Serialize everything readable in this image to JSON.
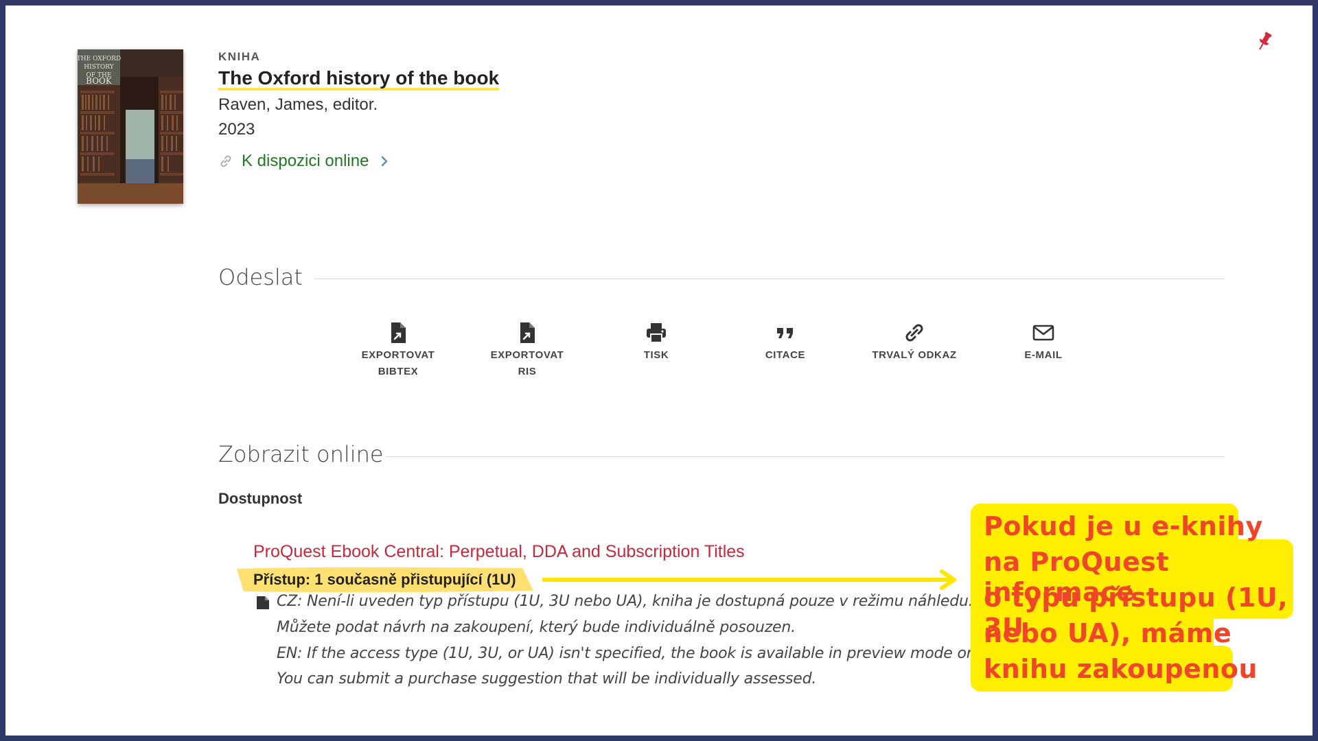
{
  "record": {
    "type": "KNIHA",
    "title": "The Oxford history of the book",
    "author": "Raven, James, editor.",
    "year": "2023",
    "online_link": "K dispozici online",
    "cover_lettering": "THE OXFORD HISTORY OF THE BOOK"
  },
  "send": {
    "heading": "Odeslat",
    "actions": [
      {
        "line1": "EXPORTOVAT",
        "line2": "BIBTEX",
        "icon": "file-export-icon"
      },
      {
        "line1": "EXPORTOVAT",
        "line2": "RIS",
        "icon": "file-export-icon"
      },
      {
        "line1": "TISK",
        "line2": "",
        "icon": "print-icon"
      },
      {
        "line1": "CITACE",
        "line2": "",
        "icon": "quote-icon"
      },
      {
        "line1": "TRVALÝ ODKAZ",
        "line2": "",
        "icon": "link-icon"
      },
      {
        "line1": "E-MAIL",
        "line2": "",
        "icon": "envelope-icon"
      }
    ]
  },
  "online_view": {
    "heading": "Zobrazit online",
    "availability_label": "Dostupnost",
    "provider": "ProQuest Ebook Central: Perpetual, DDA and Subscription Titles",
    "access": "Přístup: 1 současně přistupující (1U)",
    "notes": [
      "CZ: Není-li uveden typ přístupu (1U, 3U nebo UA), kniha je dostupná pouze v režimu náhledu.",
      "Můžete podat návrh na zakoupení, který bude individuálně posouzen.",
      "EN: If the access type (1U, 3U, or UA) isn't specified, the book is available in preview mode only.",
      "You can submit a purchase suggestion that will be individually assessed."
    ]
  },
  "callout": {
    "lines": [
      "Pokud je u e-knihy",
      "na ProQuest informace",
      "o typu přístupu (1U, 3U",
      "nebo UA), máme",
      "knihu zakoupenou"
    ]
  },
  "colors": {
    "frame": "#2f3a6b",
    "highlight": "#ffe24a",
    "callout_bg": "#ffee00",
    "callout_text": "#f1452a",
    "provider_link": "#c8283c",
    "online_link": "#1f7a1f"
  }
}
